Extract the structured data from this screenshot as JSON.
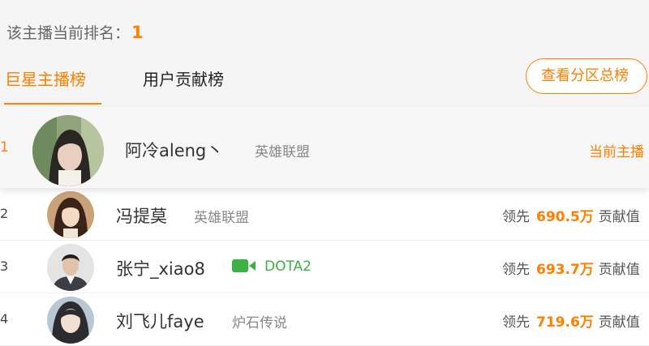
{
  "header": {
    "rank_label": "该主播当前排名：",
    "rank_value": "1"
  },
  "tabs": [
    {
      "label": "巨星主播榜",
      "active": true
    },
    {
      "label": "用户贡献榜",
      "active": false
    }
  ],
  "view_all_button": "查看分区总榜",
  "colors": {
    "accent": "#ff7f00",
    "live_green": "#3cb043",
    "background": "#f5f5f5"
  },
  "list": [
    {
      "rank": "1",
      "name": "阿冷aleng丶",
      "category": "英雄联盟",
      "status": "当前主播"
    },
    {
      "rank": "2",
      "name": "冯提莫",
      "category": "英雄联盟",
      "lead_label": "领先",
      "lead_value": "690.5万",
      "lead_suffix": "贡献值"
    },
    {
      "rank": "3",
      "name": "张宁_xiao8",
      "category": "DOTA2",
      "live_icon": "video-camera-icon",
      "lead_label": "领先",
      "lead_value": "693.7万",
      "lead_suffix": "贡献值"
    },
    {
      "rank": "4",
      "name": "刘飞儿faye",
      "category": "炉石传说",
      "lead_label": "领先",
      "lead_value": "719.6万",
      "lead_suffix": "贡献值"
    }
  ]
}
